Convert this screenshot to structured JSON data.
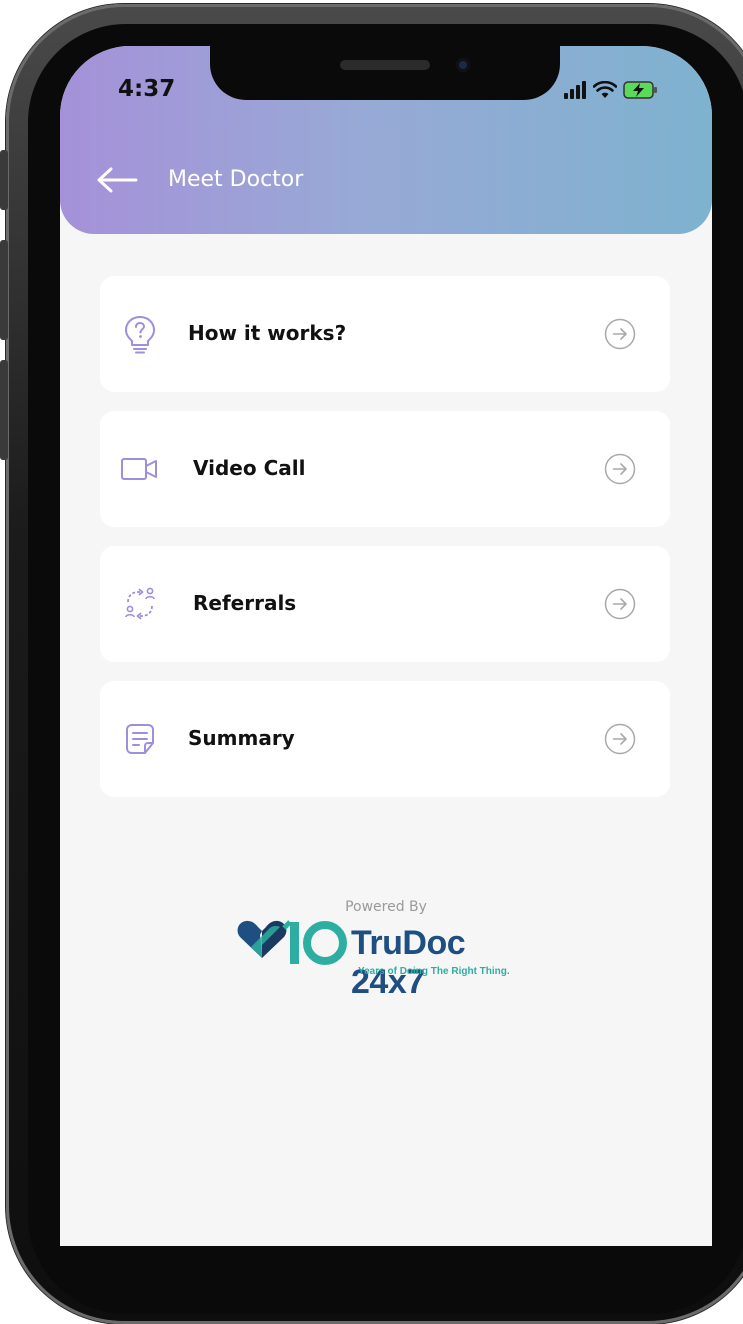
{
  "status_bar": {
    "time": "4:37",
    "icons": [
      "signal-icon",
      "wifi-icon",
      "battery-charging-icon"
    ]
  },
  "header": {
    "title": "Meet Doctor",
    "back_icon": "arrow-left-icon"
  },
  "menu": {
    "items": [
      {
        "label": "How it works?",
        "icon": "lightbulb-question-icon"
      },
      {
        "label": "Video Call",
        "icon": "video-camera-icon"
      },
      {
        "label": "Referrals",
        "icon": "referral-exchange-icon"
      },
      {
        "label": "Summary",
        "icon": "document-icon"
      }
    ],
    "arrow_icon": "circle-arrow-right-icon"
  },
  "footer": {
    "powered_by": "Powered By",
    "logo_number": "10",
    "logo_brand": "TruDoc 24x7",
    "logo_tagline": "Years of Doing The Right Thing."
  },
  "colors": {
    "header_gradient_start": "#a591d9",
    "header_gradient_end": "#7eb2cf",
    "icon_purple": "#9c8fdc",
    "logo_blue": "#1f4f80",
    "logo_teal": "#2eaea0"
  }
}
